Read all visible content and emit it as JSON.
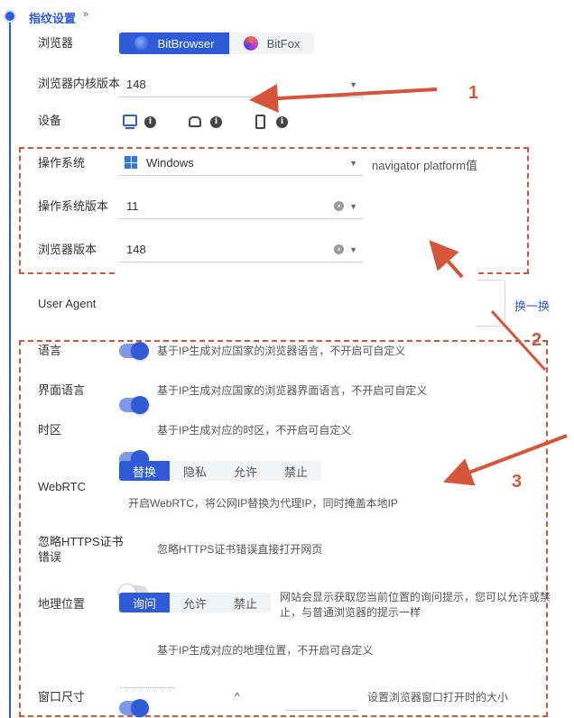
{
  "section": {
    "title": "指纹设置",
    "chevron": "»"
  },
  "browser": {
    "label": "浏览器",
    "options": [
      {
        "name": "BitBrowser",
        "active": true
      },
      {
        "name": "BitFox",
        "active": false
      }
    ]
  },
  "kernel": {
    "label": "浏览器内核版本",
    "value": "148"
  },
  "device": {
    "label": "设备"
  },
  "os": {
    "label": "操作系统",
    "value": "Windows",
    "hint": "navigator platform值"
  },
  "os_version": {
    "label": "操作系统版本",
    "value": "11"
  },
  "browser_version": {
    "label": "浏览器版本",
    "value": "148"
  },
  "user_agent": {
    "label": "User Agent",
    "refresh": "换一换"
  },
  "language": {
    "label": "语言",
    "desc": "基于IP生成对应国家的浏览器语言，不开启可自定义",
    "enabled": true
  },
  "ui_language": {
    "label": "界面语言",
    "desc": "基于IP生成对应国家的浏览器界面语言，不开启可自定义",
    "enabled": true
  },
  "timezone": {
    "label": "时区",
    "desc": "基于IP生成对应的时区，不开启可自定义",
    "enabled": true
  },
  "webrtc": {
    "label": "WebRTC",
    "options": [
      "替换",
      "隐私",
      "允许",
      "禁止"
    ],
    "selected": "替换",
    "desc": "开启WebRTC，将公网IP替换为代理IP，同时掩盖本地IP"
  },
  "https": {
    "label_line1": "忽略HTTPS证书",
    "label_line2": "错误",
    "desc": "忽略HTTPS证书错误直接打开网页",
    "enabled": false
  },
  "geo": {
    "label": "地理位置",
    "options": [
      "询问",
      "允许",
      "禁止"
    ],
    "selected": "询问",
    "desc_line1": "网站会显示获取您当前位置的询问提示，您可以允许或禁",
    "desc_line2": "止，与普通浏览器的提示一样",
    "ip_desc": "基于IP生成对应的地理位置，不开启可自定义",
    "enabled": true
  },
  "window_size": {
    "label": "窗口尺寸",
    "desc": "设置浏览器窗口打开时的大小"
  },
  "annotations": [
    "1",
    "2",
    "3"
  ],
  "colors": {
    "accent": "#2f5bd8",
    "annotation": "#d4553a"
  }
}
